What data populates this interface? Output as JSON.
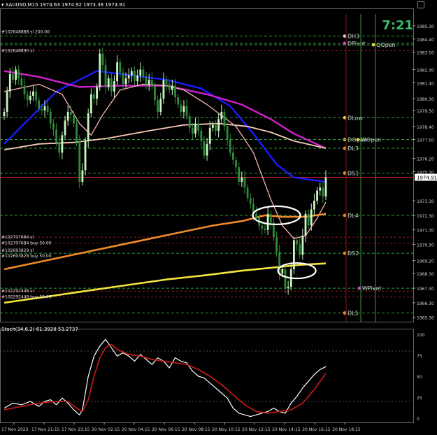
{
  "window": {
    "title": "XAUUSD,M15",
    "quote": "1974.63 1974.92 1973.38 1974.91",
    "clock": "7:21"
  },
  "colors": {
    "background": "#000000",
    "bull_candle": "#c8f5c0",
    "bear_candle": "#2f8a3a",
    "ma_blue": "#1a1aff",
    "ma_magenta": "#cc22cc",
    "ma_peach": "#f6cbb8",
    "ma_pink": "#f0a8a8",
    "ma_orange": "#f08a2a",
    "ma_yellow": "#f5e63a",
    "stoch_main": "#ffffff",
    "stoch_signal": "#cc1a1a",
    "price_marker": "#cc2222",
    "pivot_green": "#2e9e3a",
    "annotation_ellipse": "#ffffff"
  },
  "chart_data": [
    {
      "type": "candlestick",
      "symbol": "XAUUSD",
      "timeframe": "M15",
      "ylim": [
        1965.0,
        1986.5
      ],
      "last_price": 1974.91,
      "y_ticks": [
        "1985.30",
        "1984.40",
        "1983.50",
        "1982.30",
        "1981.40",
        "1980.30",
        "1979.50",
        "1978.40",
        "1977.50",
        "1976.20",
        "1975.30",
        "1974.91",
        "1973.30",
        "1972.30",
        "1971.30",
        "1970.30",
        "1969.20",
        "1968.30",
        "1967.30",
        "1966.30",
        "1965.30"
      ],
      "y_tick_values": [
        1985.3,
        1984.4,
        1983.5,
        1982.3,
        1981.4,
        1980.3,
        1979.5,
        1978.4,
        1977.5,
        1976.2,
        1975.3,
        1974.91,
        1973.3,
        1972.3,
        1971.3,
        1970.3,
        1969.2,
        1968.3,
        1967.3,
        1966.3,
        1965.3
      ],
      "x_tick_labels": [
        "17 Nov 2023",
        "17 Nov 21:15",
        "17 Nov 23:15",
        "20 Nov 02:15",
        "20 Nov 04:15",
        "20 Nov 06:15",
        "20 Nov 08:15",
        "20 Nov 10:15",
        "20 Nov 12:15",
        "20 Nov 14:15",
        "20 Nov 16:15",
        "20 Nov 18:15"
      ],
      "candles_close": [
        1979.4,
        1980.8,
        1982.0,
        1981.6,
        1982.3,
        1981.7,
        1981.2,
        1980.6,
        1980.2,
        1980.5,
        1980.8,
        1980.2,
        1979.6,
        1979.5,
        1979.8,
        1979.4,
        1978.6,
        1978.2,
        1977.3,
        1976.6,
        1977.8,
        1978.8,
        1979.4,
        1979.2,
        1978.6,
        1977.4,
        1974.6,
        1975.4,
        1977.4,
        1979.3,
        1980.6,
        1980.3,
        1981.1,
        1983.4,
        1982.6,
        1981.1,
        1981.7,
        1980.8,
        1981.5,
        1982.8,
        1982.1,
        1981.3,
        1981.7,
        1981.9,
        1982.2,
        1981.5,
        1981.9,
        1982.3,
        1981.8,
        1981.3,
        1981.6,
        1981.2,
        1980.2,
        1979.4,
        1980.3,
        1981.6,
        1981.3,
        1980.9,
        1981.2,
        1980.4,
        1979.9,
        1979.4,
        1979.8,
        1979.1,
        1978.3,
        1977.9,
        1978.6,
        1978.1,
        1977.4,
        1976.4,
        1977.2,
        1978.3,
        1978.5,
        1978.1,
        1978.9,
        1979.4,
        1978.4,
        1977.5,
        1976.6,
        1976.1,
        1975.6,
        1974.6,
        1974.9,
        1974.2,
        1973.5,
        1973.1,
        1972.4,
        1972.1,
        1971.6,
        1971.4,
        1971.3,
        1972.4,
        1971.8,
        1970.8,
        1969.8,
        1968.3,
        1968.6,
        1967.3,
        1967.4,
        1968.6,
        1970.6,
        1970.3,
        1969.6,
        1970.9,
        1972.4,
        1971.6,
        1972.7,
        1973.3,
        1974.0,
        1974.2,
        1973.6,
        1974.9
      ],
      "overlays": [
        {
          "name": "ma_blue",
          "color_key": "ma_blue",
          "width": 2.4,
          "points": [
            [
              0,
              1977.2
            ],
            [
              18,
              1980.8
            ],
            [
              32,
              1982.2
            ],
            [
              44,
              1981.9
            ],
            [
              56,
              1981.6
            ],
            [
              68,
              1981.0
            ],
            [
              78,
              1979.8
            ],
            [
              86,
              1977.9
            ],
            [
              94,
              1975.8
            ],
            [
              100,
              1974.9
            ],
            [
              111,
              1974.6
            ]
          ]
        },
        {
          "name": "ma_magenta",
          "color_key": "ma_magenta",
          "width": 2.4,
          "points": [
            [
              0,
              1982.2
            ],
            [
              12,
              1981.8
            ],
            [
              26,
              1981.1
            ],
            [
              40,
              1981.2
            ],
            [
              56,
              1981.2
            ],
            [
              70,
              1980.6
            ],
            [
              82,
              1979.9
            ],
            [
              92,
              1978.9
            ],
            [
              100,
              1977.9
            ],
            [
              111,
              1976.9
            ]
          ]
        },
        {
          "name": "ma_peach",
          "color_key": "ma_peach",
          "width": 1.8,
          "points": [
            [
              0,
              1976.8
            ],
            [
              12,
              1977.2
            ],
            [
              24,
              1977.3
            ],
            [
              36,
              1977.6
            ],
            [
              50,
              1978.1
            ],
            [
              62,
              1978.5
            ],
            [
              74,
              1978.6
            ],
            [
              84,
              1978.4
            ],
            [
              92,
              1978.0
            ],
            [
              100,
              1977.4
            ],
            [
              111,
              1976.9
            ]
          ]
        },
        {
          "name": "ma_pink",
          "color_key": "ma_pink",
          "width": 1.4,
          "points": [
            [
              0,
              1980.8
            ],
            [
              12,
              1981.3
            ],
            [
              20,
              1980.6
            ],
            [
              26,
              1978.6
            ],
            [
              30,
              1977.8
            ],
            [
              34,
              1979.2
            ],
            [
              40,
              1980.9
            ],
            [
              48,
              1981.3
            ],
            [
              56,
              1981.2
            ],
            [
              62,
              1980.9
            ],
            [
              70,
              1979.9
            ],
            [
              80,
              1978.4
            ],
            [
              86,
              1976.6
            ],
            [
              92,
              1973.4
            ],
            [
              96,
              1971.6
            ],
            [
              100,
              1970.7
            ],
            [
              104,
              1970.9
            ],
            [
              108,
              1972.1
            ],
            [
              111,
              1973.2
            ]
          ]
        },
        {
          "name": "ma_orange",
          "color_key": "ma_orange",
          "width": 2.6,
          "points": [
            [
              0,
              1968.6
            ],
            [
              12,
              1969.1
            ],
            [
              24,
              1969.6
            ],
            [
              36,
              1970.1
            ],
            [
              48,
              1970.6
            ],
            [
              60,
              1971.1
            ],
            [
              72,
              1971.6
            ],
            [
              82,
              1971.9
            ],
            [
              90,
              1972.3
            ],
            [
              96,
              1972.2
            ],
            [
              104,
              1972.2
            ],
            [
              111,
              1972.4
            ]
          ]
        },
        {
          "name": "ma_yellow",
          "color_key": "ma_yellow",
          "width": 2.6,
          "points": [
            [
              0,
              1966.3
            ],
            [
              14,
              1966.7
            ],
            [
              28,
              1967.1
            ],
            [
              42,
              1967.5
            ],
            [
              56,
              1967.9
            ],
            [
              70,
              1968.2
            ],
            [
              82,
              1968.5
            ],
            [
              92,
              1968.7
            ],
            [
              102,
              1968.9
            ],
            [
              111,
              1969.0
            ]
          ]
        }
      ],
      "levels": [
        {
          "label": "DH3",
          "price": 1984.6,
          "color_key": "pivot_green",
          "dot": "#d7d7d7"
        },
        {
          "label": "DPivot",
          "price": 1984.1,
          "color_key": "pivot_green",
          "dot": "#e040e0"
        },
        {
          "label": "QOpen",
          "price": 1984.0,
          "color_key": "pivot_green",
          "dot": "#f0d040"
        },
        {
          "label": "DLow",
          "price": 1979.0,
          "color_key": "pivot_green",
          "dot": "#f0d040"
        },
        {
          "label": "DOpen",
          "price": 1977.5,
          "color_key": "pivot_green",
          "dot": "#f0d040"
        },
        {
          "label": "WOpen",
          "price": 1977.5,
          "color_key": "pivot_green",
          "dot": "#f0d040"
        },
        {
          "label": "DL3",
          "price": 1976.9,
          "color_key": "pivot_green",
          "dot": "#f08a2a"
        },
        {
          "label": "DS1",
          "price": 1975.2,
          "color_key": "pivot_green",
          "dot": "#f08a2a"
        },
        {
          "label": "DL4",
          "price": 1972.3,
          "color_key": "pivot_green",
          "dot": "#f08a2a"
        },
        {
          "label": "DS2",
          "price": 1969.7,
          "color_key": "pivot_green",
          "dot": "#f08a2a"
        },
        {
          "label": "WPivot",
          "price": 1967.3,
          "color_key": "pivot_green",
          "dot": "#e040e0"
        },
        {
          "label": "DL5",
          "price": 1965.6,
          "color_key": "pivot_green",
          "dot": "#f08a2a"
        }
      ],
      "order_labels": [
        {
          "text": "#102648888 sl 200.00",
          "price": 1984.9
        },
        {
          "text": "#102648890 sl",
          "price": 1983.6
        },
        {
          "text": "#102707684 sl",
          "price": 1970.8
        },
        {
          "text": "#102707684 buy 50.00",
          "price": 1970.4
        },
        {
          "text": "#102693829 sl",
          "price": 1969.9
        },
        {
          "text": "#102693828 buy 50.00",
          "price": 1969.5
        },
        {
          "text": "#102292448 sl",
          "price": 1967.1
        },
        {
          "text": "#102292449 buy 50.00",
          "price": 1966.7
        }
      ],
      "annotations": [
        {
          "type": "ellipse",
          "center_bar": 94,
          "center_price": 1972.3
        },
        {
          "type": "ellipse",
          "center_bar": 101,
          "center_price": 1968.5
        }
      ]
    },
    {
      "type": "line",
      "title": "Stoch(34,6,2) 61.3928 53.2737",
      "ylim": [
        0,
        100
      ],
      "y_ticks": [
        "100",
        "75",
        "50",
        "25",
        "0"
      ],
      "y_tick_values": [
        100,
        75,
        50,
        25,
        0
      ],
      "series": [
        {
          "name": "main",
          "color_key": "stoch_main",
          "values": [
            [
              0,
              12
            ],
            [
              3,
              18
            ],
            [
              6,
              16
            ],
            [
              9,
              20
            ],
            [
              12,
              14
            ],
            [
              14,
              20
            ],
            [
              16,
              22
            ],
            [
              18,
              16
            ],
            [
              20,
              24
            ],
            [
              22,
              18
            ],
            [
              24,
              10
            ],
            [
              26,
              4
            ],
            [
              27,
              10
            ],
            [
              29,
              50
            ],
            [
              31,
              74
            ],
            [
              33,
              86
            ],
            [
              35,
              94
            ],
            [
              37,
              84
            ],
            [
              39,
              74
            ],
            [
              41,
              78
            ],
            [
              43,
              74
            ],
            [
              45,
              68
            ],
            [
              47,
              76
            ],
            [
              49,
              70
            ],
            [
              51,
              64
            ],
            [
              53,
              72
            ],
            [
              55,
              68
            ],
            [
              57,
              60
            ],
            [
              59,
              72
            ],
            [
              61,
              68
            ],
            [
              63,
              66
            ],
            [
              65,
              56
            ],
            [
              67,
              50
            ],
            [
              69,
              48
            ],
            [
              71,
              42
            ],
            [
              73,
              36
            ],
            [
              75,
              30
            ],
            [
              77,
              24
            ],
            [
              79,
              12
            ],
            [
              81,
              6
            ],
            [
              83,
              4
            ],
            [
              85,
              2
            ],
            [
              87,
              4
            ],
            [
              89,
              6
            ],
            [
              91,
              8
            ],
            [
              93,
              12
            ],
            [
              95,
              8
            ],
            [
              97,
              6
            ],
            [
              99,
              18
            ],
            [
              101,
              26
            ],
            [
              103,
              36
            ],
            [
              105,
              44
            ],
            [
              107,
              52
            ],
            [
              109,
              58
            ],
            [
              111,
              61.4
            ]
          ]
        },
        {
          "name": "signal",
          "color_key": "stoch_signal",
          "values": [
            [
              0,
              10
            ],
            [
              6,
              14
            ],
            [
              12,
              18
            ],
            [
              18,
              20
            ],
            [
              22,
              20
            ],
            [
              25,
              12
            ],
            [
              27,
              8
            ],
            [
              29,
              22
            ],
            [
              31,
              50
            ],
            [
              33,
              72
            ],
            [
              35,
              84
            ],
            [
              37,
              88
            ],
            [
              39,
              82
            ],
            [
              43,
              76
            ],
            [
              47,
              74
            ],
            [
              51,
              70
            ],
            [
              55,
              68
            ],
            [
              59,
              66
            ],
            [
              63,
              64
            ],
            [
              67,
              58
            ],
            [
              71,
              50
            ],
            [
              75,
              40
            ],
            [
              79,
              28
            ],
            [
              83,
              16
            ],
            [
              87,
              8
            ],
            [
              91,
              6
            ],
            [
              95,
              8
            ],
            [
              99,
              10
            ],
            [
              103,
              18
            ],
            [
              107,
              34
            ],
            [
              111,
              53.3
            ]
          ]
        }
      ]
    }
  ]
}
